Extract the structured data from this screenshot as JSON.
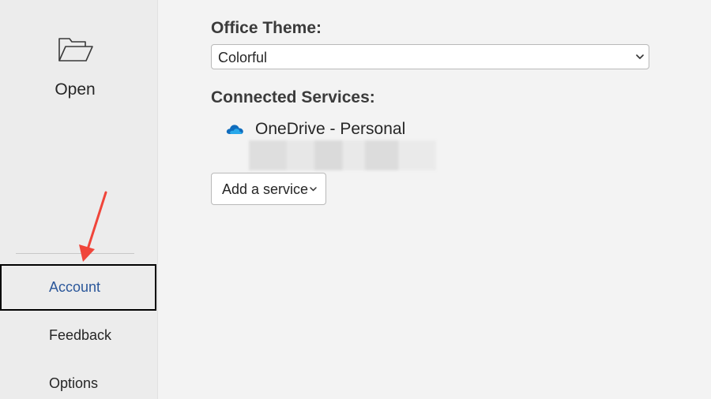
{
  "sidebar": {
    "open": {
      "label": "Open",
      "icon": "folder-open-icon"
    },
    "items": [
      {
        "label": "Account",
        "selected": true
      },
      {
        "label": "Feedback"
      },
      {
        "label": "Options"
      }
    ]
  },
  "main": {
    "theme": {
      "heading": "Office Theme:",
      "selected": "Colorful"
    },
    "services": {
      "heading": "Connected Services:",
      "items": [
        {
          "name": "OneDrive - Personal",
          "icon": "onedrive-cloud-icon"
        }
      ],
      "add_label": "Add a service"
    }
  },
  "colors": {
    "accent_text": "#2b579a",
    "annotation_arrow": "#f0453a",
    "onedrive_blue": "#0f6cbd"
  }
}
